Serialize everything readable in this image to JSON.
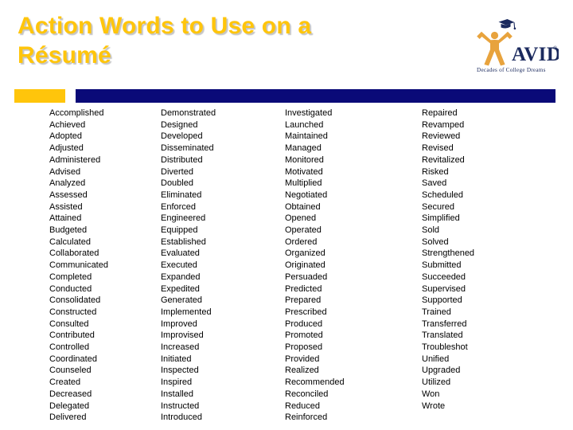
{
  "slide": {
    "title_lines": [
      "Action Words to Use on a",
      "Résumé"
    ],
    "title_color": "#FFC50B",
    "accent_bar_gold_color": "#FFC50B",
    "accent_bar_navy_color": "#0A0A78",
    "background_color": "#FFFFFF",
    "body_text_color": "#000000"
  },
  "logo": {
    "name": "AVID",
    "wordmark": "AVID",
    "registered_mark": "®",
    "tagline": "Decades of College Dreams",
    "figure_color": "#E8A33D",
    "text_color": "#1B2A5E"
  },
  "columns": [
    {
      "index": 0,
      "words": [
        "Accomplished",
        "Achieved",
        "Adopted",
        "Adjusted",
        "Administered",
        "Advised",
        "Analyzed",
        "Assessed",
        "Assisted",
        "Attained",
        "Budgeted",
        "Calculated",
        "Collaborated",
        "Communicated",
        "Completed",
        "Conducted",
        "Consolidated",
        "Constructed",
        "Consulted",
        "Contributed",
        "Controlled",
        "Coordinated",
        "Counseled",
        "Created",
        "Decreased",
        "Delegated",
        "Delivered"
      ]
    },
    {
      "index": 1,
      "words": [
        "Demonstrated",
        "Designed",
        "Developed",
        "Disseminated",
        "Distributed",
        "Diverted",
        "Doubled",
        "Eliminated",
        "Enforced",
        "Engineered",
        "Equipped",
        "Established",
        "Evaluated",
        "Executed",
        "Expanded",
        "Expedited",
        "Generated",
        "Implemented",
        "Improved",
        "Improvised",
        "Increased",
        "Initiated",
        "Inspected",
        "Inspired",
        "Installed",
        "Instructed",
        "Introduced"
      ]
    },
    {
      "index": 2,
      "words": [
        "Investigated",
        "Launched",
        "Maintained",
        "Managed",
        "Monitored",
        "Motivated",
        "Multiplied",
        "Negotiated",
        "Obtained",
        "Opened",
        "Operated",
        "Ordered",
        "Organized",
        "Originated",
        "Persuaded",
        "Predicted",
        "Prepared",
        "Prescribed",
        "Produced",
        "Promoted",
        "Proposed",
        "Provided",
        "Realized",
        "Recommended",
        "Reconciled",
        "Reduced",
        "Reinforced"
      ]
    },
    {
      "index": 3,
      "words": [
        "Repaired",
        "Revamped",
        "Reviewed",
        "Revised",
        "Revitalized",
        "Risked",
        "Saved",
        "Scheduled",
        "Secured",
        "Simplified",
        "Sold",
        "Solved",
        "Strengthened",
        "Submitted",
        "Succeeded",
        "Supervised",
        "Supported",
        "Trained",
        "Transferred",
        "Translated",
        "Troubleshot",
        "Unified",
        "Upgraded",
        "Utilized",
        "Won",
        "Wrote"
      ]
    }
  ]
}
